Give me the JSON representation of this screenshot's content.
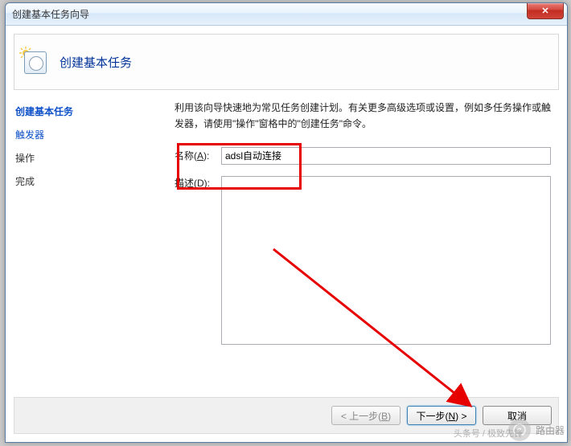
{
  "window": {
    "title": "创建基本任务向导",
    "close_glyph": "✕"
  },
  "header": {
    "title": "创建基本任务"
  },
  "sidebar": {
    "items": [
      {
        "label": "创建基本任务",
        "state": "active"
      },
      {
        "label": "触发器",
        "state": "link"
      },
      {
        "label": "操作",
        "state": "normal"
      },
      {
        "label": "完成",
        "state": "normal"
      }
    ]
  },
  "form": {
    "description_text": "利用该向导快速地为常见任务创建计划。有关更多高级选项或设置，例如多任务操作或触发器，请使用\"操作\"窗格中的\"创建任务\"命令。",
    "name_label_pre": "名称(",
    "name_label_ak": "A",
    "name_label_post": "):",
    "name_value": "adsl自动连接",
    "desc_label_pre": "描述(",
    "desc_label_ak": "D",
    "desc_label_post": "):",
    "desc_value": ""
  },
  "buttons": {
    "back_pre": "< 上一步(",
    "back_ak": "B",
    "back_post": ")",
    "next_pre": "下一步(",
    "next_ak": "N",
    "next_post": ") >",
    "cancel": "取消"
  },
  "watermark": {
    "label": "路由器",
    "footer_credit": "头条号 / 极致先锋"
  }
}
